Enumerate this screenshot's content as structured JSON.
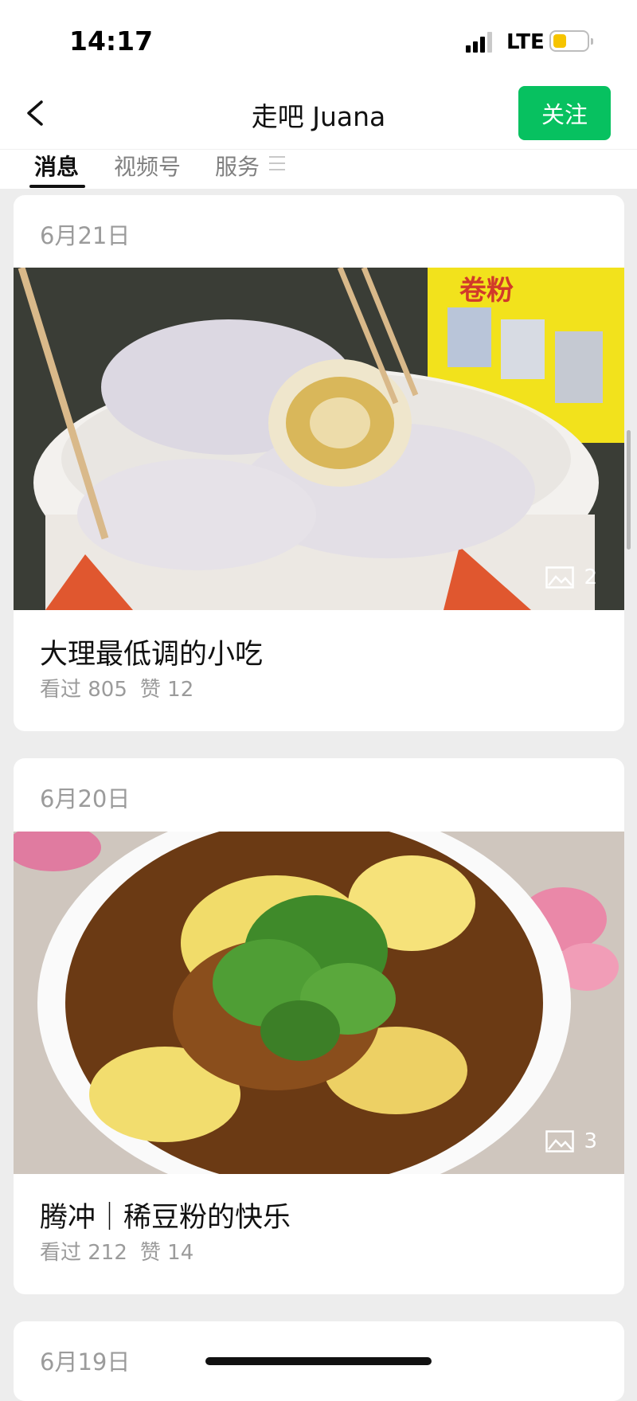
{
  "status_bar": {
    "time": "14:17",
    "network": "LTE"
  },
  "header": {
    "title": "走吧 Juana",
    "follow_label": "关注"
  },
  "tabs": [
    {
      "label": "消息",
      "active": true
    },
    {
      "label": "视频号",
      "active": false
    },
    {
      "label": "服务",
      "active": false
    }
  ],
  "posts": [
    {
      "date": "6月21日",
      "title": "大理最低调的小吃",
      "views": "看过 805",
      "likes": "赞 12",
      "image_count": "2",
      "image_icon": "image-icon"
    },
    {
      "date": "6月20日",
      "title": "腾冲｜稀豆粉的快乐",
      "views": "看过 212",
      "likes": "赞 14",
      "image_count": "3",
      "image_icon": "image-icon"
    },
    {
      "date": "6月19日"
    }
  ],
  "colors": {
    "accent": "#07c160",
    "background": "#ededed",
    "muted_text": "#9b9b9b",
    "battery": "#f6c400"
  }
}
